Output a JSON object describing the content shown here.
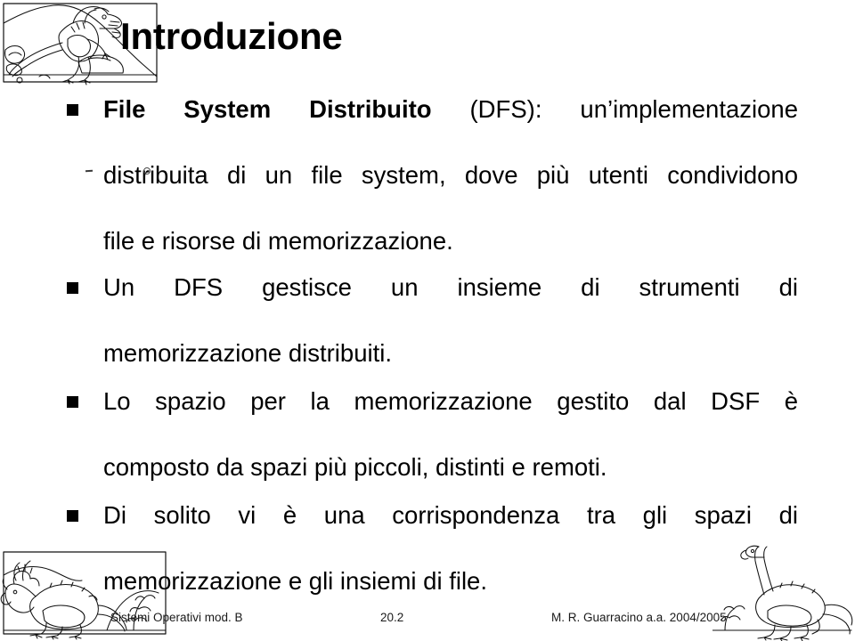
{
  "slide": {
    "title": "Introduzione",
    "bullets": [
      {
        "id": "bullet-dfs-definition",
        "marker": "filled-square-bullet",
        "lines": [
          {
            "strong": "File  System  Distribuito",
            "rest": "  (DFS):  un’implementazione"
          },
          {
            "text": "distribuita di un file system, dove più utenti condividono"
          },
          {
            "text": "file e risorse di memorizzazione."
          }
        ]
      },
      {
        "id": "bullet-dfs-manages",
        "marker": "filled-square-bullet",
        "lines": [
          {
            "text": "Un DFS gestisce un insieme di strumenti di"
          },
          {
            "text": "memorizzazione distribuiti."
          }
        ]
      },
      {
        "id": "bullet-storage-space",
        "marker": "filled-square-bullet",
        "lines": [
          {
            "text": "Lo spazio per la memorizzazione gestito dal DSF è"
          },
          {
            "text": "composto da spazi più piccoli, distinti e remoti."
          }
        ]
      },
      {
        "id": "bullet-correspondence",
        "marker": "filled-square-bullet",
        "lines": [
          {
            "text": "Di solito vi è una corrispondenza tra gli spazi di"
          },
          {
            "text": "memorizzazione e gli insiemi di file."
          }
        ]
      }
    ],
    "footer": {
      "left": "Sistemi Operativi mod. B",
      "center": "20.2",
      "right": "M. R. Guarracino a.a. 2004/2005"
    },
    "decorations": {
      "top_left": "raptor-dinosaur-illustration",
      "bottom_left": "triceratops-dinosaur-illustration",
      "bottom_right": "sauropod-dinosaur-illustration"
    },
    "colors": {
      "background": "#ffffff",
      "text": "#000000",
      "footer_text": "#1a1a1a"
    }
  }
}
